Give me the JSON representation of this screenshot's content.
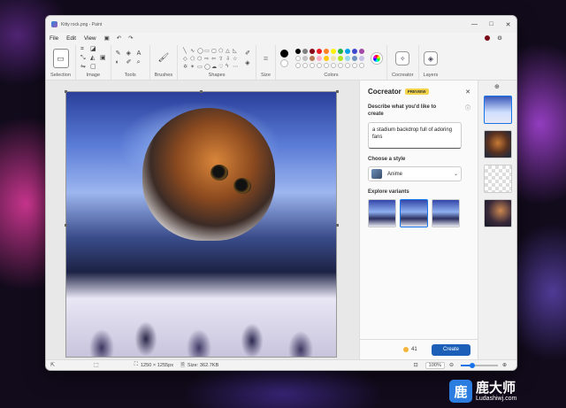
{
  "window": {
    "title": "Kitty rock.png - Paint"
  },
  "titlebar": {
    "controls": [
      "—",
      "□",
      "✕"
    ]
  },
  "menu": {
    "items": [
      "File",
      "Edit",
      "View"
    ],
    "icons": [
      "save-icon",
      "undo-icon",
      "redo-icon"
    ]
  },
  "ribbon": {
    "groups": [
      {
        "label": "Selection"
      },
      {
        "label": "Image"
      },
      {
        "label": "Tools"
      },
      {
        "label": "Brushes"
      },
      {
        "label": "Shapes"
      },
      {
        "label": "Size"
      },
      {
        "label": "Colors"
      },
      {
        "label": "Cocreator"
      },
      {
        "label": "Layers"
      }
    ],
    "colors": {
      "primary": "#000000",
      "secondary": "#ffffff",
      "palette_row1": [
        "#000000",
        "#7f7f7f",
        "#880015",
        "#ed1c24",
        "#ff7f27",
        "#fff200",
        "#22b14c",
        "#00a2e8",
        "#3f48cc",
        "#a349a4"
      ],
      "palette_row2": [
        "#ffffff",
        "#c3c3c3",
        "#b97a57",
        "#ffaec9",
        "#ffc90e",
        "#efe4b0",
        "#b5e61d",
        "#99d9ea",
        "#7092be",
        "#c8bfe7"
      ]
    }
  },
  "cocreator": {
    "title": "Cocreator",
    "badge": "PREVIEW",
    "describe_label": "Describe what you'd like to create",
    "prompt": "a stadium backdrop full of adoring fans",
    "style_label": "Choose a style",
    "style": "Anime",
    "variants_label": "Explore variants",
    "credits": "41",
    "create_label": "Create"
  },
  "status": {
    "dimensions": "1250 × 1255px",
    "size": "Size: 362.7KB",
    "zoom": "100%",
    "zoom_fraction": 0.3
  },
  "watermark": {
    "cn": "鹿大师",
    "url": "Ludashiwj.com",
    "logo": "鹿"
  }
}
